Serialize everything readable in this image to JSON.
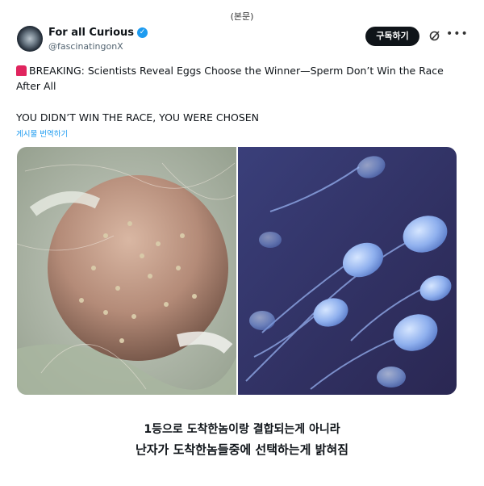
{
  "top_note": "(본문)",
  "post": {
    "author": {
      "display_name": "For all Curious",
      "handle": "@fascinatingonX",
      "verified": true
    },
    "subscribe_label": "구독하기",
    "headline": "BREAKING: Scientists Reveal Eggs Choose the Winner—Sperm Don’t Win the Race After All",
    "subheadline": "YOU DIDN’T WIN THE RACE, YOU WERE CHOSEN",
    "translate_label": "게시물 번역하기",
    "icons": {
      "siren": "siren-emoji",
      "verified": "verified-badge-icon",
      "grok": "grok-icon",
      "more": "more-horizontal-icon"
    }
  },
  "caption": {
    "line1": "1등으로 도착한놈이랑 결합되는게 아니라",
    "line2": "난자가 도착한놈들중에 선택하는게 밝혀짐"
  },
  "colors": {
    "accent": "#1d9bf0",
    "button_bg": "#0f1419",
    "siren": "#e0245e"
  }
}
